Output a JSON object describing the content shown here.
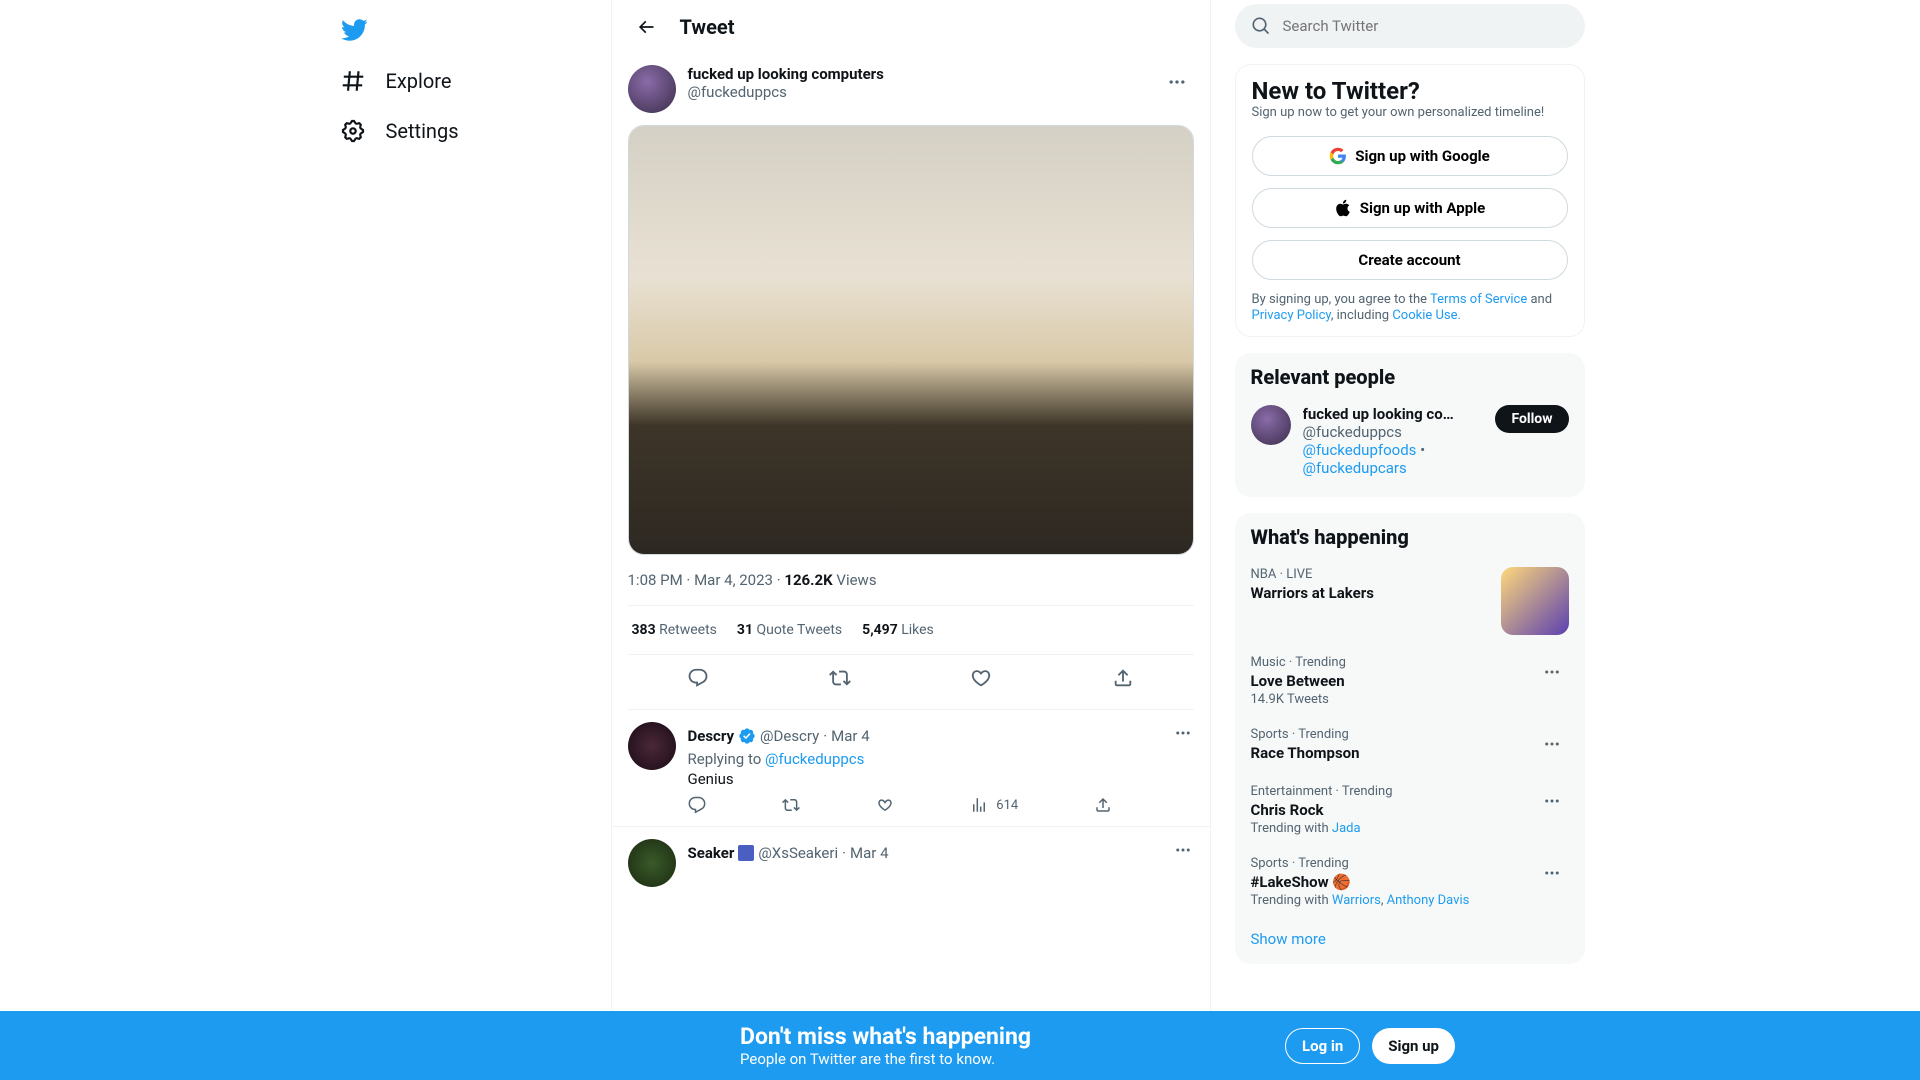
{
  "nav": {
    "explore": "Explore",
    "settings": "Settings"
  },
  "header": {
    "title": "Tweet"
  },
  "tweet": {
    "author_name": "fucked up looking computers",
    "author_handle": "@fuckeduppcs",
    "time": "1:08 PM",
    "date": "Mar 4, 2023",
    "views_count": "126.2K",
    "views_label": "Views",
    "stats": {
      "retweets_num": "383",
      "retweets_label": "Retweets",
      "quotes_num": "31",
      "quotes_label": "Quote Tweets",
      "likes_num": "5,497",
      "likes_label": "Likes"
    }
  },
  "replies": [
    {
      "name": "Descry",
      "verified": true,
      "handle": "@Descry",
      "date": "Mar 4",
      "replying_to_label": "Replying to",
      "replying_to_handle": "@fuckeduppcs",
      "text": "Genius",
      "views": "614"
    },
    {
      "name": "Seaker",
      "badge": true,
      "handle": "@XsSeakeri",
      "date": "Mar 4"
    }
  ],
  "search": {
    "placeholder": "Search Twitter"
  },
  "signup_card": {
    "title": "New to Twitter?",
    "desc": "Sign up now to get your own personalized timeline!",
    "google": "Sign up with Google",
    "apple": "Sign up with Apple",
    "create": "Create account",
    "fine1": "By signing up, you agree to the ",
    "tos": "Terms of Service",
    "fine2": " and ",
    "privacy": "Privacy Policy",
    "fine3": ", including ",
    "cookie": "Cookie Use."
  },
  "relevant": {
    "title": "Relevant people",
    "person_name": "fucked up looking co…",
    "person_handle": "@fuckeduppcs",
    "follow": "Follow",
    "link1": "@fuckedupfoods",
    "sep": " • ",
    "link2": "@fuckedupcars"
  },
  "happening": {
    "title": "What's happening",
    "items": [
      {
        "cat": "NBA · LIVE",
        "title": "Warriors at Lakers",
        "thumb": true
      },
      {
        "cat": "Music · Trending",
        "title": "Love Between",
        "sub": "14.9K Tweets",
        "more": true
      },
      {
        "cat": "Sports · Trending",
        "title": "Race Thompson",
        "more": true
      },
      {
        "cat": "Entertainment · Trending",
        "title": "Chris Rock",
        "sub_prefix": "Trending with ",
        "sub_link": "Jada",
        "more": true
      },
      {
        "cat": "Sports · Trending",
        "title": "#LakeShow 🏀",
        "sub_prefix": "Trending with ",
        "sub_link": "Warriors",
        "sub_sep": ", ",
        "sub_link2": "Anthony Davis",
        "more": true
      }
    ],
    "show_more": "Show more"
  },
  "banner": {
    "title": "Don't miss what's happening",
    "subtitle": "People on Twitter are the first to know.",
    "login": "Log in",
    "signup": "Sign up"
  }
}
